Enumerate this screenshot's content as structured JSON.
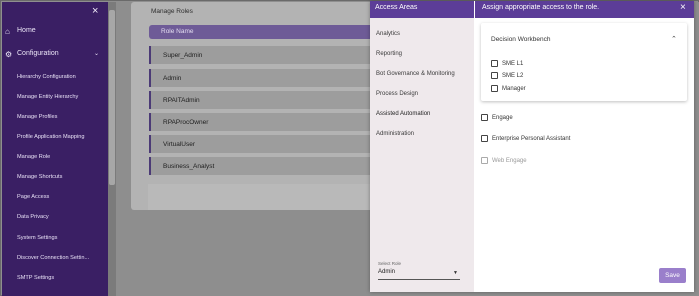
{
  "sidebar": {
    "close_label": "×",
    "home": {
      "icon": "home-icon",
      "label": "Home"
    },
    "configuration": {
      "icon": "gear-icon",
      "label": "Configuration",
      "expand_icon": "chevron-down-icon"
    },
    "items": [
      {
        "label": "Hierarchy Configuration"
      },
      {
        "label": "Manage Entity Hierarchy"
      },
      {
        "label": "Manage Profiles"
      },
      {
        "label": "Profile Application Mapping"
      },
      {
        "label": "Manage Role"
      },
      {
        "label": "Manage Shortcuts"
      },
      {
        "label": "Page Access"
      },
      {
        "label": "Data Privacy"
      },
      {
        "label": "System Settings"
      },
      {
        "label": "Discover Connection Settin..."
      },
      {
        "label": "SMTP Settings"
      }
    ]
  },
  "main": {
    "card_title": "Manage Roles",
    "column_header": "Role Name",
    "roles": [
      "Super_Admin",
      "Admin",
      "RPAITAdmin",
      "RPAProcOwner",
      "VirtualUser",
      "Business_Analyst"
    ]
  },
  "modal": {
    "left_title": "Access Areas",
    "right_title": "Assign appropriate access to the role.",
    "close_label": "×",
    "areas": [
      {
        "label": "Analytics"
      },
      {
        "label": "Reporting"
      },
      {
        "label": "Bot Governance & Monitoring"
      },
      {
        "label": "Process Design"
      },
      {
        "label": "Assisted Automation"
      },
      {
        "label": "Administration"
      }
    ],
    "select_role": {
      "label": "Select Role",
      "value": "Admin"
    },
    "panel": {
      "title": "Decision Workbench",
      "options": [
        "SME L1",
        "SME L2",
        "Manager"
      ]
    },
    "extra_options": [
      {
        "label": "Engage",
        "disabled": false
      },
      {
        "label": "Enterprise Personal Assistant",
        "disabled": false
      },
      {
        "label": "Web Engage",
        "disabled": true
      }
    ],
    "save_label": "Save"
  },
  "colors": {
    "sidebar_bg": "#3a1f64",
    "accent": "#5c3d98",
    "save_button": "#9a7fcb"
  }
}
